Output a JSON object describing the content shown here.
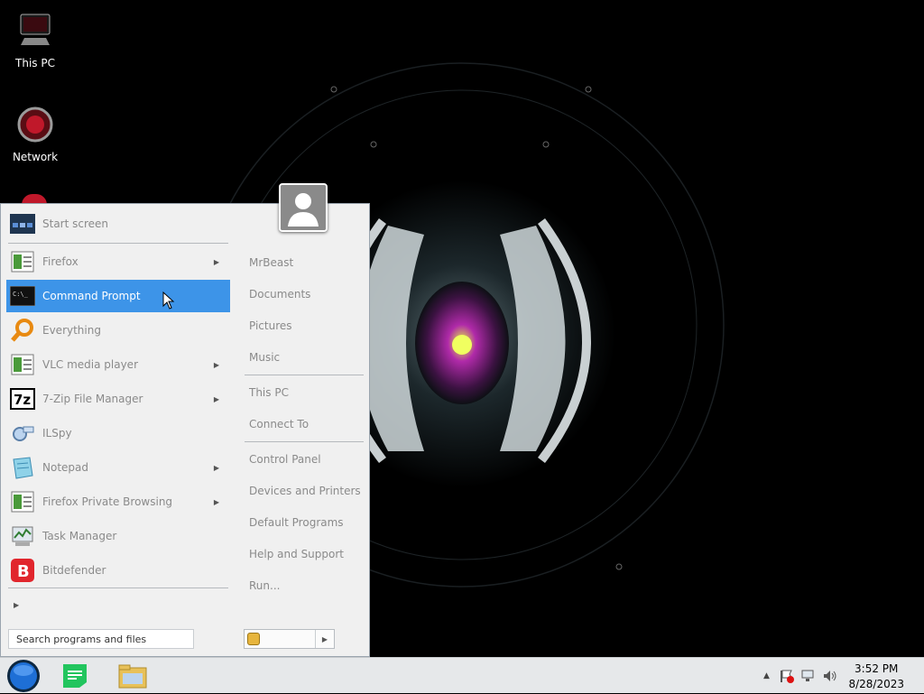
{
  "desktop": {
    "icons": [
      {
        "label": "This PC"
      },
      {
        "label": "Network"
      }
    ]
  },
  "start_menu": {
    "pinned": {
      "label": "Start screen"
    },
    "programs": [
      {
        "label": "Firefox",
        "has_submenu": true
      },
      {
        "label": "Command Prompt",
        "has_submenu": false,
        "selected": true
      },
      {
        "label": "Everything",
        "has_submenu": false
      },
      {
        "label": "VLC media player",
        "has_submenu": true
      },
      {
        "label": "7-Zip File Manager",
        "has_submenu": true
      },
      {
        "label": "ILSpy",
        "has_submenu": false
      },
      {
        "label": "Notepad",
        "has_submenu": true
      },
      {
        "label": "Firefox Private Browsing",
        "has_submenu": true
      },
      {
        "label": "Task Manager",
        "has_submenu": false
      },
      {
        "label": "Bitdefender",
        "has_submenu": false
      }
    ],
    "right_column": [
      {
        "label": "MrBeast"
      },
      {
        "label": "Documents"
      },
      {
        "label": "Pictures"
      },
      {
        "label": "Music"
      },
      {
        "label": "This PC"
      },
      {
        "label": "Connect To"
      },
      {
        "label": "Control Panel"
      },
      {
        "label": "Devices and Printers"
      },
      {
        "label": "Default Programs"
      },
      {
        "label": "Help and Support"
      },
      {
        "label": "Run..."
      }
    ],
    "search": {
      "placeholder": "Search programs and files"
    },
    "selection_color": "#3d94e8"
  },
  "taskbar": {
    "buttons": [
      {
        "icon": "notes-app-icon",
        "color": "#22c55e"
      },
      {
        "icon": "file-explorer-icon",
        "color": "#e8c15a"
      }
    ],
    "tray": {
      "icons": [
        "show-hidden-icons-arrow",
        "action-center-flag-icon",
        "network-icon",
        "volume-icon"
      ]
    },
    "clock": {
      "time": "3:52 PM",
      "date": "8/28/2023"
    }
  }
}
